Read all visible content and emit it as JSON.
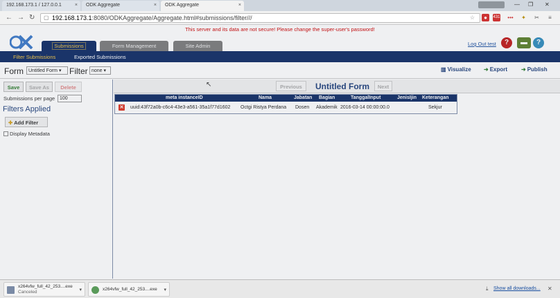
{
  "browser": {
    "tabs": [
      "192.168.173.1 / 127.0.0.1",
      "ODK Aggregate",
      "ODK Aggregate"
    ],
    "active_tab_index": 2,
    "url_host": "192.168.173.1",
    "url_rest": ":8080/ODKAggregate/Aggregate.html#submissions/filter///",
    "ext_badge": "431"
  },
  "warning": "This server and its data are not secure! Please change the super-user's password!",
  "app_tabs": [
    "Submissions",
    "Form Management",
    "Site Admin"
  ],
  "logout_label": "Log Out test",
  "subnav": [
    "Filter Submissions",
    "Exported Submissions"
  ],
  "formbar": {
    "form_label": "Form",
    "form_value": "Untitled Form",
    "filter_label": "Filter",
    "filter_value": "none",
    "visualize": "Visualize",
    "export": "Export",
    "publish": "Publish"
  },
  "left": {
    "save": "Save",
    "save_as": "Save As",
    "delete": "Delete",
    "per_page_label": "Submissions per page",
    "per_page_value": "100",
    "filters_applied": "Filters Applied",
    "add_filter": "Add Filter",
    "display_metadata": "Display Metadata"
  },
  "pager": {
    "previous": "Previous",
    "title": "Untitled Form",
    "next": "Next"
  },
  "table": {
    "columns": [
      "meta instanceID",
      "Nama",
      "Jabatan",
      "Bagian",
      "TanggalInput",
      "JenisIjin",
      "Keterangan"
    ],
    "rows": [
      [
        "uuid:43f72a0b-c6c4-43e3-a561-35a1f77d1602",
        "Octgi Ristya Perdana",
        "Dosen",
        "Akademik",
        "2016-03-14 00:00:00.0",
        "",
        "Sekjur"
      ]
    ]
  },
  "downloads": {
    "items": [
      {
        "name": "x264vfw_full_42_253....exe",
        "status": "Canceled"
      },
      {
        "name": "x264vfw_full_42_253....exe",
        "status": ""
      }
    ],
    "show_all": "Show all downloads..."
  }
}
